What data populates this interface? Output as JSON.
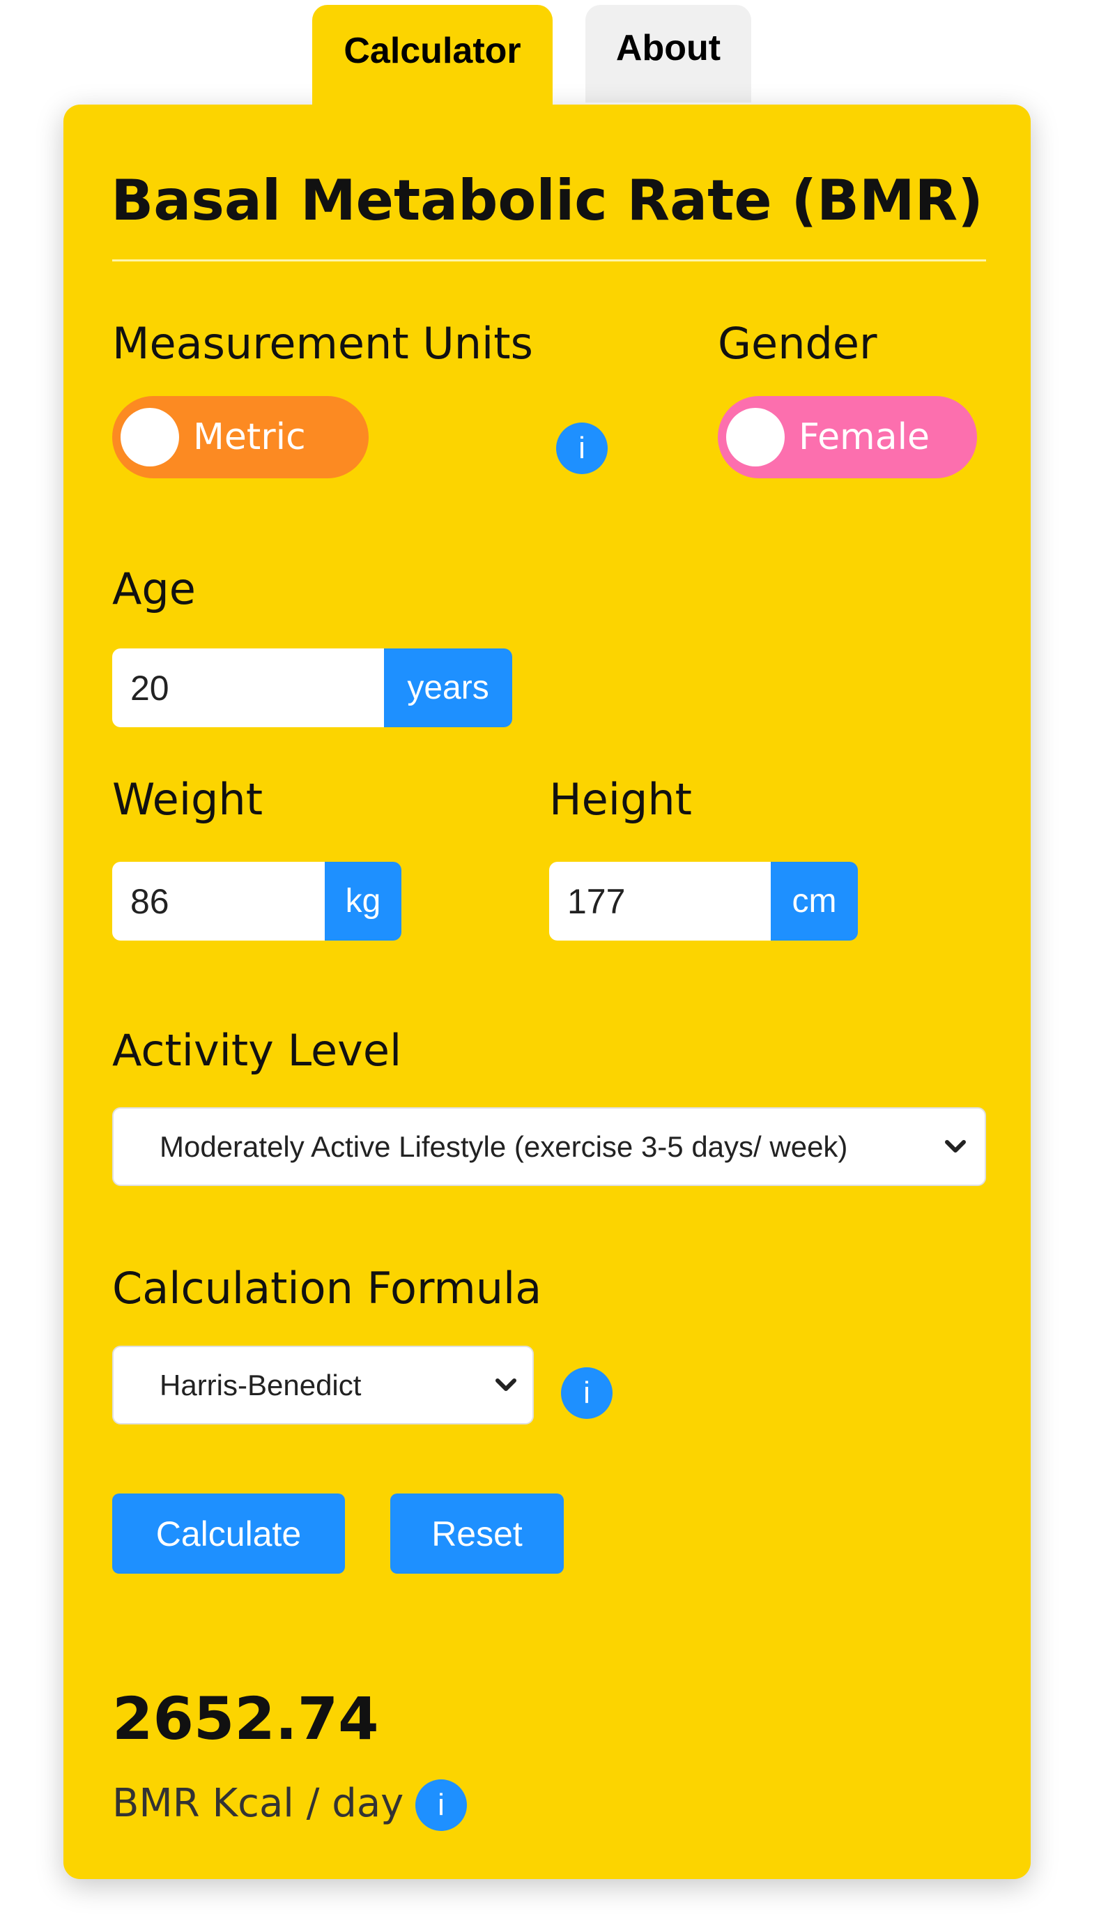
{
  "tabs": {
    "calculator": "Calculator",
    "about": "About"
  },
  "title": "Basal Metabolic Rate (BMR)",
  "units": {
    "label": "Measurement Units",
    "toggle_value": "Metric",
    "color": "#fc8a22"
  },
  "gender": {
    "label": "Gender",
    "toggle_value": "Female",
    "color": "#fc6fae"
  },
  "age": {
    "label": "Age",
    "value": "20",
    "unit": "years"
  },
  "weight": {
    "label": "Weight",
    "value": "86",
    "unit": "kg"
  },
  "height": {
    "label": "Height",
    "value": "177",
    "unit": "cm"
  },
  "activity": {
    "label": "Activity Level",
    "selected": "Moderately Active Lifestyle (exercise 3-5 days/ week)"
  },
  "formula": {
    "label": "Calculation Formula",
    "selected": "Harris-Benedict"
  },
  "buttons": {
    "calculate": "Calculate",
    "reset": "Reset"
  },
  "result": {
    "value": "2652.74",
    "unit": "BMR Kcal / day"
  },
  "info_glyph": "i",
  "colors": {
    "card": "#fcd400",
    "accent": "#1e90ff"
  }
}
